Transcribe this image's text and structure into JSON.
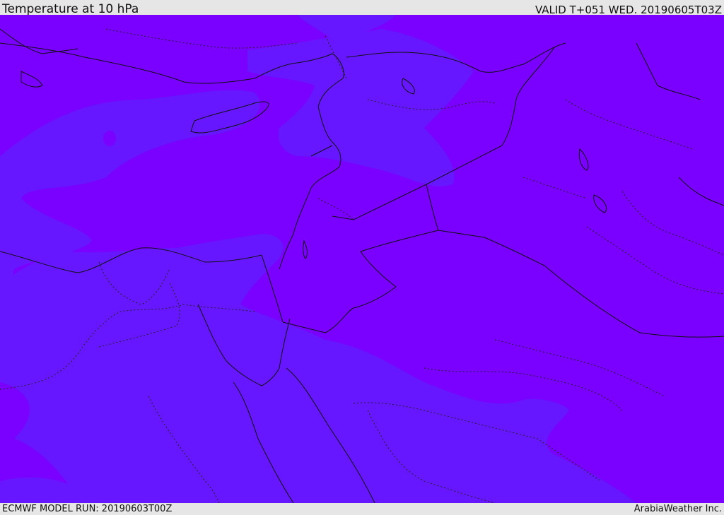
{
  "header": {
    "title": "Temperature at 10 hPa",
    "valid": "VALID T+051 WED. 20190605T03Z"
  },
  "footer": {
    "model_run": "ECMWF MODEL RUN: 20190603T00Z",
    "credit": "ArabiaWeather Inc."
  },
  "colors": {
    "background_field": "#7a00ff",
    "warmer_band": "#6617ff",
    "coastline": "#111111",
    "border": "#111111",
    "panel": "#e6e6e6"
  }
}
